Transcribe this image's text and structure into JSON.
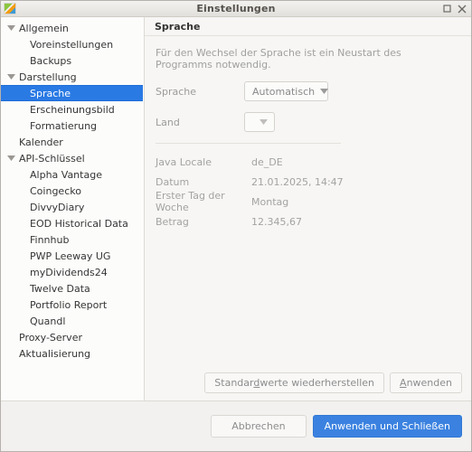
{
  "window": {
    "title": "Einstellungen",
    "icon": "app-icon",
    "maximize_label": "maximize-icon",
    "close_label": "close-icon"
  },
  "sidebar": {
    "items": [
      {
        "label": "Allgemein",
        "level": 0,
        "expandable": true,
        "selected": false
      },
      {
        "label": "Voreinstellungen",
        "level": 1,
        "expandable": false,
        "selected": false
      },
      {
        "label": "Backups",
        "level": 1,
        "expandable": false,
        "selected": false
      },
      {
        "label": "Darstellung",
        "level": 0,
        "expandable": true,
        "selected": false
      },
      {
        "label": "Sprache",
        "level": 1,
        "expandable": false,
        "selected": true
      },
      {
        "label": "Erscheinungsbild",
        "level": 1,
        "expandable": false,
        "selected": false
      },
      {
        "label": "Formatierung",
        "level": 1,
        "expandable": false,
        "selected": false
      },
      {
        "label": "Kalender",
        "level": 0,
        "expandable": false,
        "selected": false
      },
      {
        "label": "API-Schlüssel",
        "level": 0,
        "expandable": true,
        "selected": false
      },
      {
        "label": "Alpha Vantage",
        "level": 1,
        "expandable": false,
        "selected": false
      },
      {
        "label": "Coingecko",
        "level": 1,
        "expandable": false,
        "selected": false
      },
      {
        "label": "DivvyDiary",
        "level": 1,
        "expandable": false,
        "selected": false
      },
      {
        "label": "EOD Historical Data",
        "level": 1,
        "expandable": false,
        "selected": false
      },
      {
        "label": "Finnhub",
        "level": 1,
        "expandable": false,
        "selected": false
      },
      {
        "label": "PWP Leeway UG",
        "level": 1,
        "expandable": false,
        "selected": false
      },
      {
        "label": "myDividends24",
        "level": 1,
        "expandable": false,
        "selected": false
      },
      {
        "label": "Twelve Data",
        "level": 1,
        "expandable": false,
        "selected": false
      },
      {
        "label": "Portfolio Report",
        "level": 1,
        "expandable": false,
        "selected": false
      },
      {
        "label": "Quandl",
        "level": 1,
        "expandable": false,
        "selected": false
      },
      {
        "label": "Proxy-Server",
        "level": 0,
        "expandable": false,
        "selected": false
      },
      {
        "label": "Aktualisierung",
        "level": 0,
        "expandable": false,
        "selected": false
      }
    ]
  },
  "content": {
    "header": "Sprache",
    "hint": "Für den Wechsel der Sprache ist ein Neustart des Programms notwendig.",
    "fields": [
      {
        "label": "Sprache",
        "value": "Automatisch"
      },
      {
        "label": "Land",
        "value": ""
      }
    ],
    "info": [
      {
        "label": "Java Locale",
        "value": "de_DE"
      },
      {
        "label": "Datum",
        "value": "21.01.2025, 14:47"
      },
      {
        "label": "Erster Tag der Woche",
        "value": "Montag"
      },
      {
        "label": "Betrag",
        "value": "12.345,67"
      }
    ],
    "buttons": {
      "restore_defaults": "Standardwerte wiederherstellen",
      "apply": "Anwenden"
    }
  },
  "footer": {
    "cancel": "Abbrechen",
    "apply_close": "Anwenden und Schließen"
  },
  "colors": {
    "accent": "#3b82e0",
    "selection": "#2a7ae4",
    "window_bg": "#f2f1ef",
    "panel_bg": "#f7f6f4",
    "sidebar_bg": "#fcfcfb",
    "muted_text": "#a3a3a3"
  }
}
